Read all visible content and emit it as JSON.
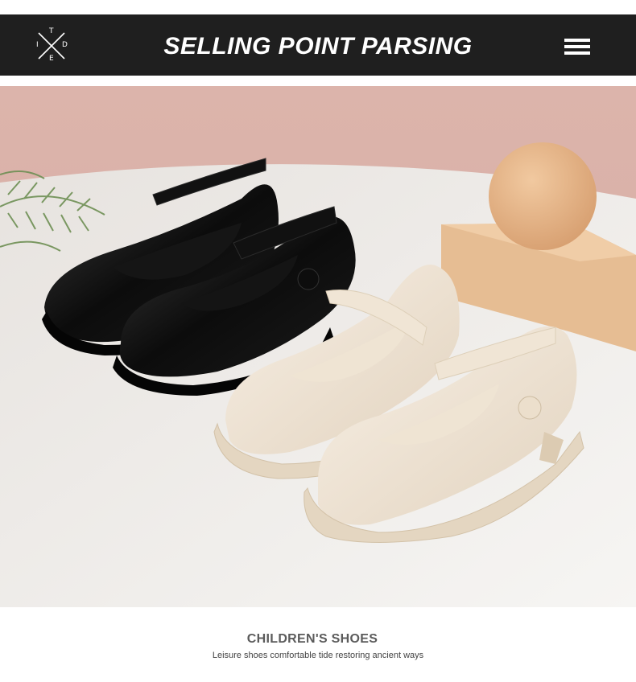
{
  "header": {
    "logo_letters": {
      "top": "T",
      "left": "I",
      "right": "D",
      "bottom": "E"
    },
    "title": "SELLING POINT PARSING",
    "menu_icon": "hamburger-menu-icon"
  },
  "product_photo": {
    "subject": "two pairs of children's mary jane shoes (black patent and cream)"
  },
  "caption": {
    "title": "CHILDREN'S SHOES",
    "subtitle": "Leisure shoes comfortable tide restoring ancient ways"
  },
  "colors": {
    "header_bg": "#1f1f1f",
    "header_text": "#ffffff",
    "caption_title": "#5b5b5b",
    "caption_subtitle": "#444444",
    "backdrop_pink": "#d8b1a9",
    "table_white": "#f3f1ee",
    "shoe_black": "#0e0e0e",
    "shoe_cream": "#eee3d3",
    "ball": "#e4b88d",
    "block": "#e9c29a"
  }
}
